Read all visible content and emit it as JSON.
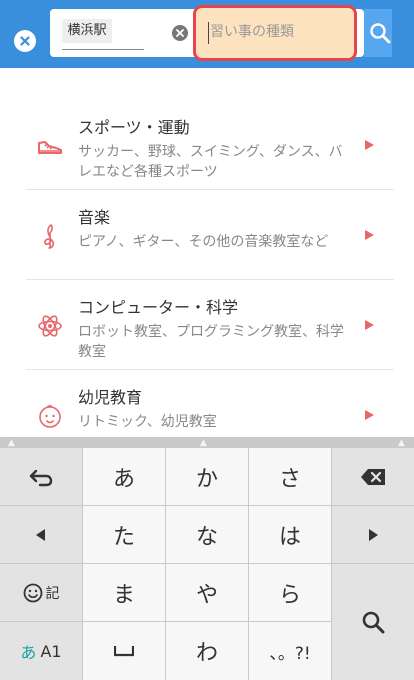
{
  "header": {
    "station_chip": "横浜駅",
    "kind_placeholder": "習い事の種類",
    "accent_color": "#3a8fdd",
    "highlight_border_color": "#e8454a"
  },
  "categories": [
    {
      "title": "スポーツ・運動",
      "desc": "サッカー、野球、スイミング、ダンス、バレエなど各種スポーツ",
      "icon": "sneaker-icon"
    },
    {
      "title": "音楽",
      "desc": "ピアノ、ギター、その他の音楽教室など",
      "icon": "treble-clef-icon"
    },
    {
      "title": "コンピューター・科学",
      "desc": "ロボット教室、プログラミング教室、科学教室",
      "icon": "atom-icon"
    },
    {
      "title": "幼児教育",
      "desc": "リトミック、幼児教室",
      "icon": "baby-face-icon"
    }
  ],
  "keyboard": {
    "row1": [
      "あ",
      "か",
      "さ"
    ],
    "row2": [
      "た",
      "な",
      "は"
    ],
    "row3": [
      "ま",
      "や",
      "ら"
    ],
    "row4": [
      "わ",
      "、。?!"
    ],
    "emoji_label": "記",
    "mode_label_kana": "あ",
    "mode_label_alpha": "A1"
  }
}
